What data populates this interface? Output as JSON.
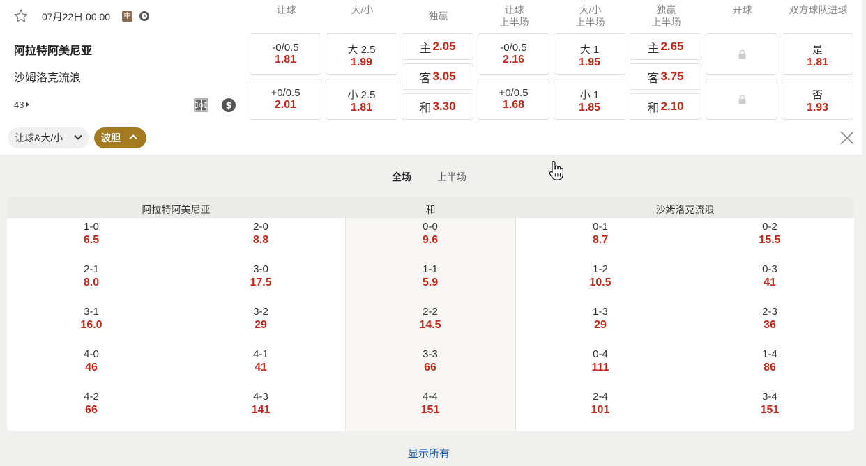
{
  "match": {
    "datetime": "07月22日 00:00",
    "badge": "中",
    "home": "阿拉特阿美尼亚",
    "away": "沙姆洛克流浪",
    "more_count": "43"
  },
  "headers": [
    "让球",
    "大/小",
    "独赢",
    "让球\n上半场",
    "大/小\n上半场",
    "独赢\n上半场",
    "开球",
    "双方球队进球"
  ],
  "odds": {
    "handicap": [
      {
        "line": "-0/0.5",
        "odd": "1.81"
      },
      {
        "line": "+0/0.5",
        "odd": "2.01"
      }
    ],
    "total": [
      {
        "line": "大 2.5",
        "odd": "1.99"
      },
      {
        "line": "小 2.5",
        "odd": "1.81"
      }
    ],
    "moneyline": [
      {
        "label": "主",
        "odd": "2.05"
      },
      {
        "label": "客",
        "odd": "3.05"
      },
      {
        "label": "和",
        "odd": "3.30"
      }
    ],
    "handicap_1h": [
      {
        "line": "-0/0.5",
        "odd": "2.16"
      },
      {
        "line": "+0/0.5",
        "odd": "1.68"
      }
    ],
    "total_1h": [
      {
        "line": "大 1",
        "odd": "1.95"
      },
      {
        "line": "小 1",
        "odd": "1.85"
      }
    ],
    "moneyline_1h": [
      {
        "label": "主",
        "odd": "2.65"
      },
      {
        "label": "客",
        "odd": "3.75"
      },
      {
        "label": "和",
        "odd": "2.10"
      }
    ],
    "btts": [
      {
        "line": "是",
        "odd": "1.81"
      },
      {
        "line": "否",
        "odd": "1.93"
      }
    ]
  },
  "filters": {
    "market": "让球&大/小",
    "active": "波胆"
  },
  "tabs": {
    "full": "全场",
    "first_half": "上半场"
  },
  "correct_score": {
    "headers": {
      "home": "阿拉特阿美尼亚",
      "draw": "和",
      "away": "沙姆洛克流浪"
    },
    "home_a": [
      {
        "s": "1-0",
        "o": "6.5"
      },
      {
        "s": "2-1",
        "o": "8.0"
      },
      {
        "s": "3-1",
        "o": "16.0"
      },
      {
        "s": "4-0",
        "o": "46"
      },
      {
        "s": "4-2",
        "o": "66"
      }
    ],
    "home_b": [
      {
        "s": "2-0",
        "o": "8.8"
      },
      {
        "s": "3-0",
        "o": "17.5"
      },
      {
        "s": "3-2",
        "o": "29"
      },
      {
        "s": "4-1",
        "o": "41"
      },
      {
        "s": "4-3",
        "o": "141"
      }
    ],
    "draw": [
      {
        "s": "0-0",
        "o": "9.6"
      },
      {
        "s": "1-1",
        "o": "5.9"
      },
      {
        "s": "2-2",
        "o": "14.5"
      },
      {
        "s": "3-3",
        "o": "66"
      },
      {
        "s": "4-4",
        "o": "151"
      }
    ],
    "away_a": [
      {
        "s": "0-1",
        "o": "8.7"
      },
      {
        "s": "1-2",
        "o": "10.5"
      },
      {
        "s": "1-3",
        "o": "29"
      },
      {
        "s": "0-4",
        "o": "111"
      },
      {
        "s": "2-4",
        "o": "101"
      }
    ],
    "away_b": [
      {
        "s": "0-2",
        "o": "15.5"
      },
      {
        "s": "0-3",
        "o": "41"
      },
      {
        "s": "2-3",
        "o": "36"
      },
      {
        "s": "1-4",
        "o": "86"
      },
      {
        "s": "3-4",
        "o": "151"
      }
    ]
  },
  "show_all": "显示所有"
}
